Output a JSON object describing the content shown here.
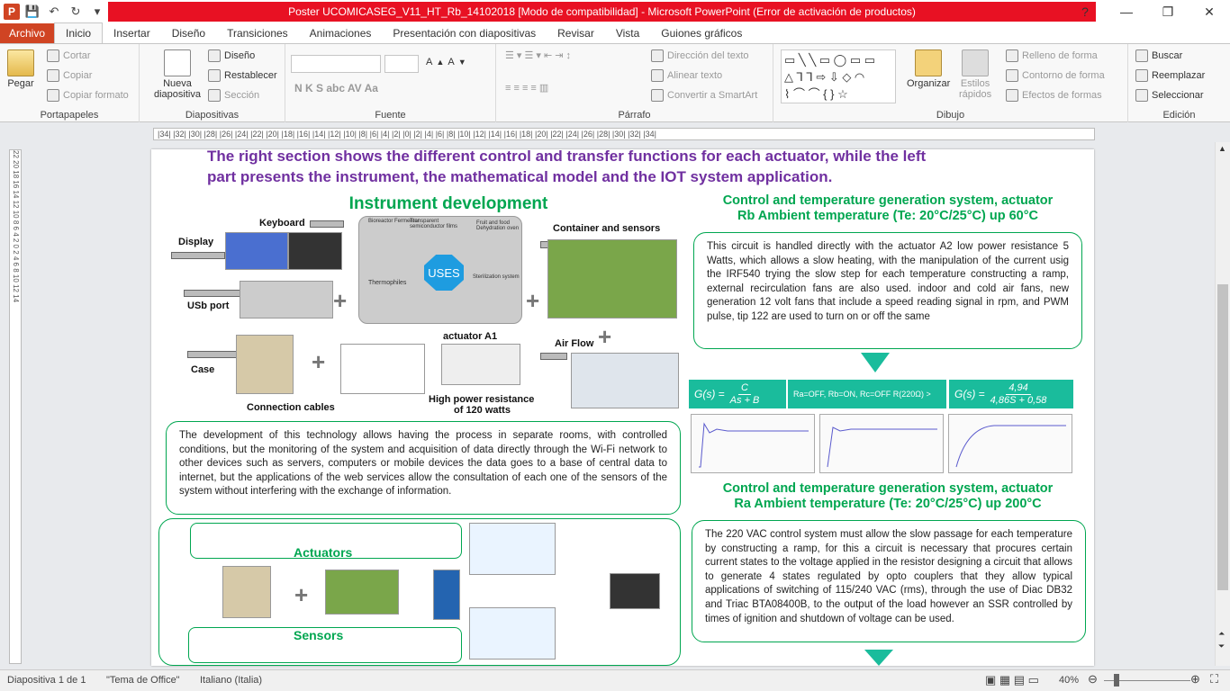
{
  "window": {
    "title": "Poster UCOMICASEG_V11_HT_Rb_14102018 [Modo de compatibilidad] - Microsoft PowerPoint (Error de activación de productos)"
  },
  "qat": {
    "app_icon": "P",
    "undo": "↶",
    "redo": "↻"
  },
  "tabs": [
    "Archivo",
    "Inicio",
    "Insertar",
    "Diseño",
    "Transiciones",
    "Animaciones",
    "Presentación con diapositivas",
    "Revisar",
    "Vista",
    "Guiones gráficos"
  ],
  "ribbon": {
    "portapapeles": {
      "label": "Portapapeles",
      "pegar": "Pegar",
      "cortar": "Cortar",
      "copiar": "Copiar",
      "copiar_formato": "Copiar formato"
    },
    "diapositivas": {
      "label": "Diapositivas",
      "nueva": "Nueva",
      "nueva2": "diapositiva",
      "diseno": "Diseño",
      "restablecer": "Restablecer",
      "seccion": "Sección"
    },
    "fuente": {
      "label": "Fuente",
      "buttons": "N  K  S  abc  AV  Aa"
    },
    "parrafo": {
      "label": "Párrafo",
      "direccion": "Dirección del texto",
      "alinear": "Alinear texto",
      "convertir": "Convertir a SmartArt"
    },
    "dibujo": {
      "label": "Dibujo",
      "organizar": "Organizar",
      "estilos": "Estilos",
      "estilos2": "rápidos",
      "relleno": "Relleno de forma",
      "contorno": "Contorno de forma",
      "efectos": "Efectos de formas"
    },
    "edicion": {
      "label": "Edición",
      "buscar": "Buscar",
      "reemplazar": "Reemplazar",
      "seleccionar": "Seleccionar"
    }
  },
  "ruler_ticks": "|34|  |32|  |30|  |28|  |26|  |24|  |22|  |20|  |18|  |16|  |14|  |12|  |10|  |8|  |6|  |4|  |2|  |0|  |2|  |4|  |6|  |8|  |10|  |12|  |14|  |16|  |18|  |20|  |22|  |24|  |26|  |28|  |30|  |32|  |34|",
  "vruler_ticks": "22 20 18 16 14 12 10 8 6 4 2 0 2 4 6 8 10 12 14",
  "slide": {
    "intro1": "The right section shows the different control and transfer functions for each actuator, while the left",
    "intro2": "part presents the instrument, the mathematical model and the IOT system application.",
    "instr_title": "Instrument development",
    "labels": {
      "keyboard": "Keyboard",
      "display": "Display",
      "usb": "USb port",
      "case": "Case",
      "cables": "Connection cables",
      "container": "Container and sensors",
      "airflow": "Air Flow",
      "actuator_a1": "actuator A1",
      "hp1": "High power resistance",
      "hp2": "of 120 watts",
      "uses": "USES",
      "bioreactor": "Bioreactor Fermentor",
      "transparent": "Transparent semiconductor films",
      "fruit": "Fruit and food Dehydration oven",
      "thermophiles": "Thermophiles",
      "sterilization": "Sterilization system"
    },
    "dev_text": "The development of this technology allows having the process in separate rooms, with controlled conditions, but the monitoring of the system and acquisition of data directly through the Wi-Fi network to other devices such as servers, computers or mobile devices the data goes to a base of central data to internet, but the applications of the web services allow the consultation of each one of the sensors of the system without interfering with the exchange of information.",
    "actuators": "Actuators",
    "sensors": "Sensors",
    "rb_title1": "Control and temperature generation system, actuator",
    "rb_title2": "Rb   Ambient temperature (Te: 20°C/25°C) up 60°C",
    "rb_text": "This circuit is handled directly with the actuator A2 low power resistance 5 Watts, which allows a slow heating, with the manipulation of the current usig the IRF540 trying the slow step for each temperature constructing a ramp, external recirculation fans are also used. indoor and cold air fans, new generation 12 volt fans that include a speed reading signal in rpm, and PWM pulse, tip 122 are used to turn on or off the same",
    "eq1_lhs": "G(s) =",
    "eq1_num": "C",
    "eq1_den": "As + B",
    "eq_mid": "Ra=OFF, Rb=ON, Rc=OFF  R(220Ω) >",
    "eq2_lhs": "G(s) =",
    "eq2_num": "4,94",
    "eq2_den": "4,86S + 0,58",
    "ra_title1": "Control and temperature generation system, actuator",
    "ra_title2": "Ra Ambient temperature (Te: 20°C/25°C) up 200°C",
    "ra_text": "The 220 VAC control system must allow the slow passage for each temperature by constructing a ramp, for this a circuit is necessary that procures certain current states to the voltage applied in the resistor designing a circuit that allows to generate 4 states regulated by opto couplers that they allow typical applications of switching of 115/240 VAC (rms), through the use of Diac DB32 and Triac BTA08400B, to the output of the load however an SSR controlled by times of ignition and shutdown of voltage can be used."
  },
  "status": {
    "slide": "Diapositiva 1 de 1",
    "theme": "\"Tema de Office\"",
    "lang": "Italiano (Italia)",
    "zoom": "40%"
  },
  "colors": {
    "accent": "#d04423",
    "title_bar": "#e81123",
    "green": "#00a650",
    "purple": "#7030a0",
    "teal": "#1abc9c"
  }
}
